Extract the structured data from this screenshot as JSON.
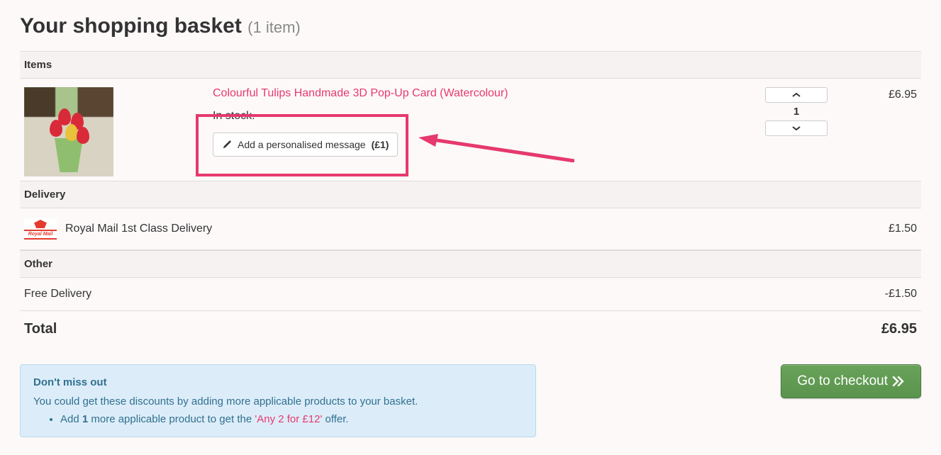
{
  "header": {
    "title": "Your shopping basket",
    "count_text": "(1 item)"
  },
  "sections": {
    "items": "Items",
    "delivery": "Delivery",
    "other": "Other",
    "total": "Total"
  },
  "item": {
    "name": "Colourful Tulips Handmade 3D Pop-Up Card (Watercolour)",
    "stock": "In stock.",
    "personalise_label": "Add a personalised message",
    "personalise_price": "(£1)",
    "quantity": "1",
    "price": "£6.95"
  },
  "delivery": {
    "method": "Royal Mail 1st Class Delivery",
    "price": "£1.50"
  },
  "other": {
    "label": "Free Delivery",
    "price": "-£1.50"
  },
  "total": {
    "price": "£6.95"
  },
  "promo": {
    "title": "Don't miss out",
    "lead": "You could get these discounts by adding more applicable products to your basket.",
    "bullet_pre": "Add ",
    "bullet_count": "1",
    "bullet_mid": " more applicable product to get the ",
    "bullet_offer": "'Any 2 for £12'",
    "bullet_post": " offer."
  },
  "checkout": {
    "label": "Go to checkout"
  }
}
